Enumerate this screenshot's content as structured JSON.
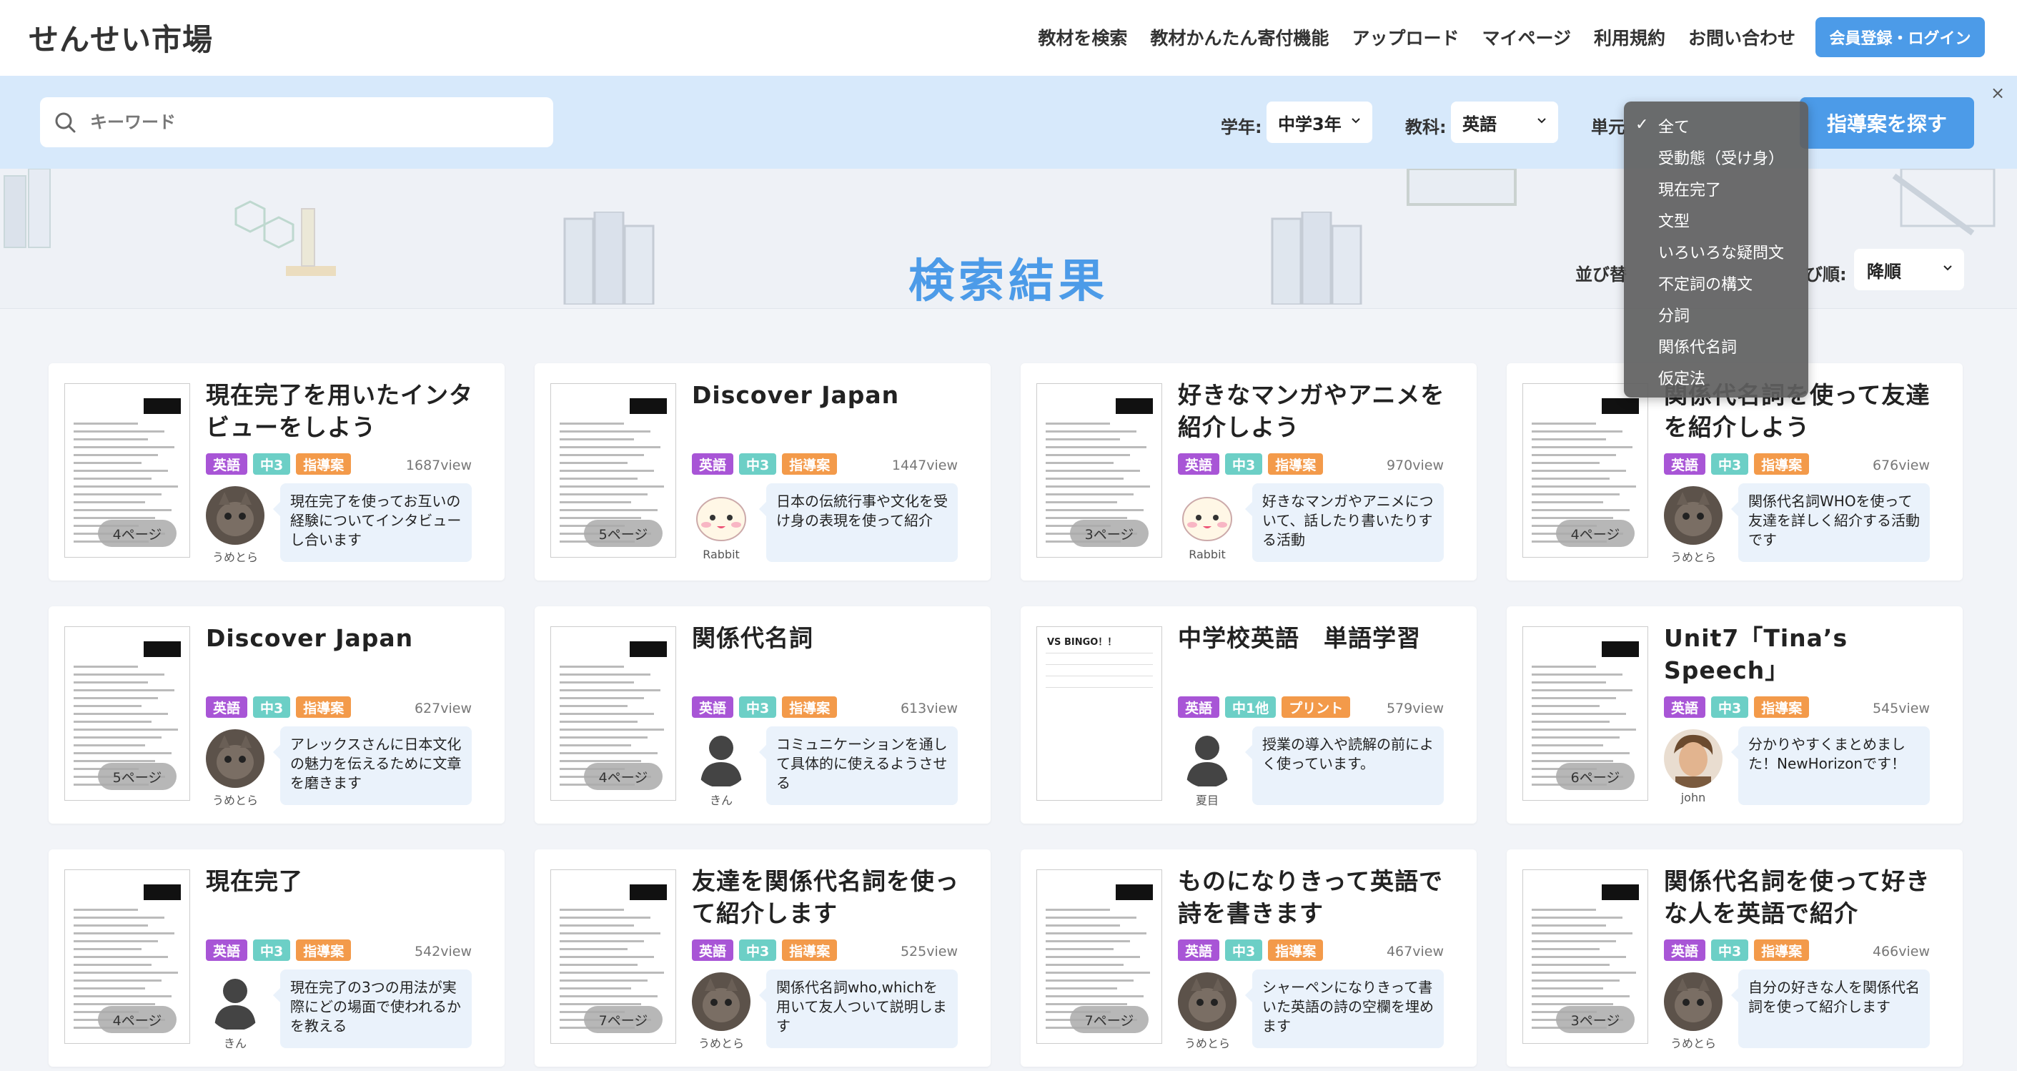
{
  "header": {
    "logo_text": "せんせい市場",
    "nav": [
      "教材を検索",
      "教材かんたん寄付機能",
      "アップロード",
      "マイページ",
      "利用規約",
      "お問い合わせ"
    ],
    "login_label": "会員登録・ログイン"
  },
  "search": {
    "placeholder": "キーワード",
    "grade_label": "学年:",
    "grade_value": "中学3年",
    "subject_label": "教科:",
    "subject_value": "英語",
    "unit_label": "単元",
    "find_label": "指導案を探す",
    "close_symbol": "×"
  },
  "results": {
    "title": "検索結果",
    "sort_label_partial": "並び替",
    "order_label_partial": "び順:",
    "order_value": "降順"
  },
  "unit_dropdown": {
    "selected": "全て",
    "options": [
      "全て",
      "受動態（受け身）",
      "現在完了",
      "文型",
      "いろいろな疑問文",
      "不定詞の構文",
      "分詞",
      "関係代名詞",
      "仮定法"
    ]
  },
  "colors": {
    "accent": "#4c9be8",
    "tag_english": "#a855d6",
    "tag_grade": "#6ccfc6",
    "tag_plan": "#f39a4a",
    "tag_print": "#f39a4a"
  },
  "cards": [
    {
      "title": "現在完了を用いたインタビューをしよう",
      "tags": [
        "英語",
        "中3",
        "指導案"
      ],
      "views": "1687view",
      "pages": "4ページ",
      "author": "うめとら",
      "avatar": "photo-cat",
      "desc": "現在完了を使ってお互いの経験についてインタビューし合います"
    },
    {
      "title": "Discover Japan",
      "tags": [
        "英語",
        "中3",
        "指導案"
      ],
      "views": "1447view",
      "pages": "5ページ",
      "author": "Rabbit",
      "avatar": "rabbit",
      "desc": "日本の伝統行事や文化を受け身の表現を使って紹介"
    },
    {
      "title": "好きなマンガやアニメを紹介しよう",
      "tags": [
        "英語",
        "中3",
        "指導案"
      ],
      "views": "970view",
      "pages": "3ページ",
      "author": "Rabbit",
      "avatar": "rabbit",
      "desc": "好きなマンガやアニメについて、話したり書いたりする活動"
    },
    {
      "title": "関係代名詞を使って友達を紹介しよう",
      "tags": [
        "英語",
        "中3",
        "指導案"
      ],
      "views": "676view",
      "pages": "4ページ",
      "author": "うめとら",
      "avatar": "photo-cat",
      "desc": "関係代名詞WHOを使って友達を詳しく紹介する活動です"
    },
    {
      "title": "Discover Japan",
      "tags": [
        "英語",
        "中3",
        "指導案"
      ],
      "views": "627view",
      "pages": "5ページ",
      "author": "うめとら",
      "avatar": "photo-cat",
      "desc": "アレックスさんに日本文化の魅力を伝えるために文章を磨きます"
    },
    {
      "title": "関係代名詞",
      "tags": [
        "英語",
        "中3",
        "指導案"
      ],
      "views": "613view",
      "pages": "4ページ",
      "author": "きん",
      "avatar": "silhouette",
      "desc": "コミュニケーションを通して具体的に使えるようさせる"
    },
    {
      "title": "中学校英語　単語学習",
      "tags": [
        "英語",
        "中1他",
        "プリント"
      ],
      "views": "579view",
      "pages": "",
      "author": "夏目",
      "avatar": "silhouette",
      "desc": "授業の導入や読解の前によく使っています。",
      "thumb_text": "VS BINGO！！"
    },
    {
      "title": "Unit7「Tina’s Speech」",
      "tags": [
        "英語",
        "中3",
        "指導案"
      ],
      "views": "545view",
      "pages": "6ページ",
      "author": "john",
      "avatar": "illustration-man",
      "desc": "分かりやすくまとめました！NewHorizonです！"
    },
    {
      "title": "現在完了",
      "tags": [
        "英語",
        "中3",
        "指導案"
      ],
      "views": "542view",
      "pages": "4ページ",
      "author": "きん",
      "avatar": "silhouette",
      "desc": "現在完了の3つの用法が実際にどの場面で使われるかを教える"
    },
    {
      "title": "友達を関係代名詞を使って紹介します",
      "tags": [
        "英語",
        "中3",
        "指導案"
      ],
      "views": "525view",
      "pages": "7ページ",
      "author": "うめとら",
      "avatar": "photo-cat",
      "desc": "関係代名詞who,whichを用いて友人ついて説明します"
    },
    {
      "title": "ものになりきって英語で詩を書きます",
      "tags": [
        "英語",
        "中3",
        "指導案"
      ],
      "views": "467view",
      "pages": "7ページ",
      "author": "うめとら",
      "avatar": "photo-cat",
      "desc": "シャーペンになりきって書いた英語の詩の空欄を埋めます"
    },
    {
      "title": "関係代名詞を使って好きな人を英語で紹介",
      "tags": [
        "英語",
        "中3",
        "指導案"
      ],
      "views": "466view",
      "pages": "3ページ",
      "author": "うめとら",
      "avatar": "photo-cat",
      "desc": "自分の好きな人を関係代名詞を使って紹介します"
    }
  ]
}
